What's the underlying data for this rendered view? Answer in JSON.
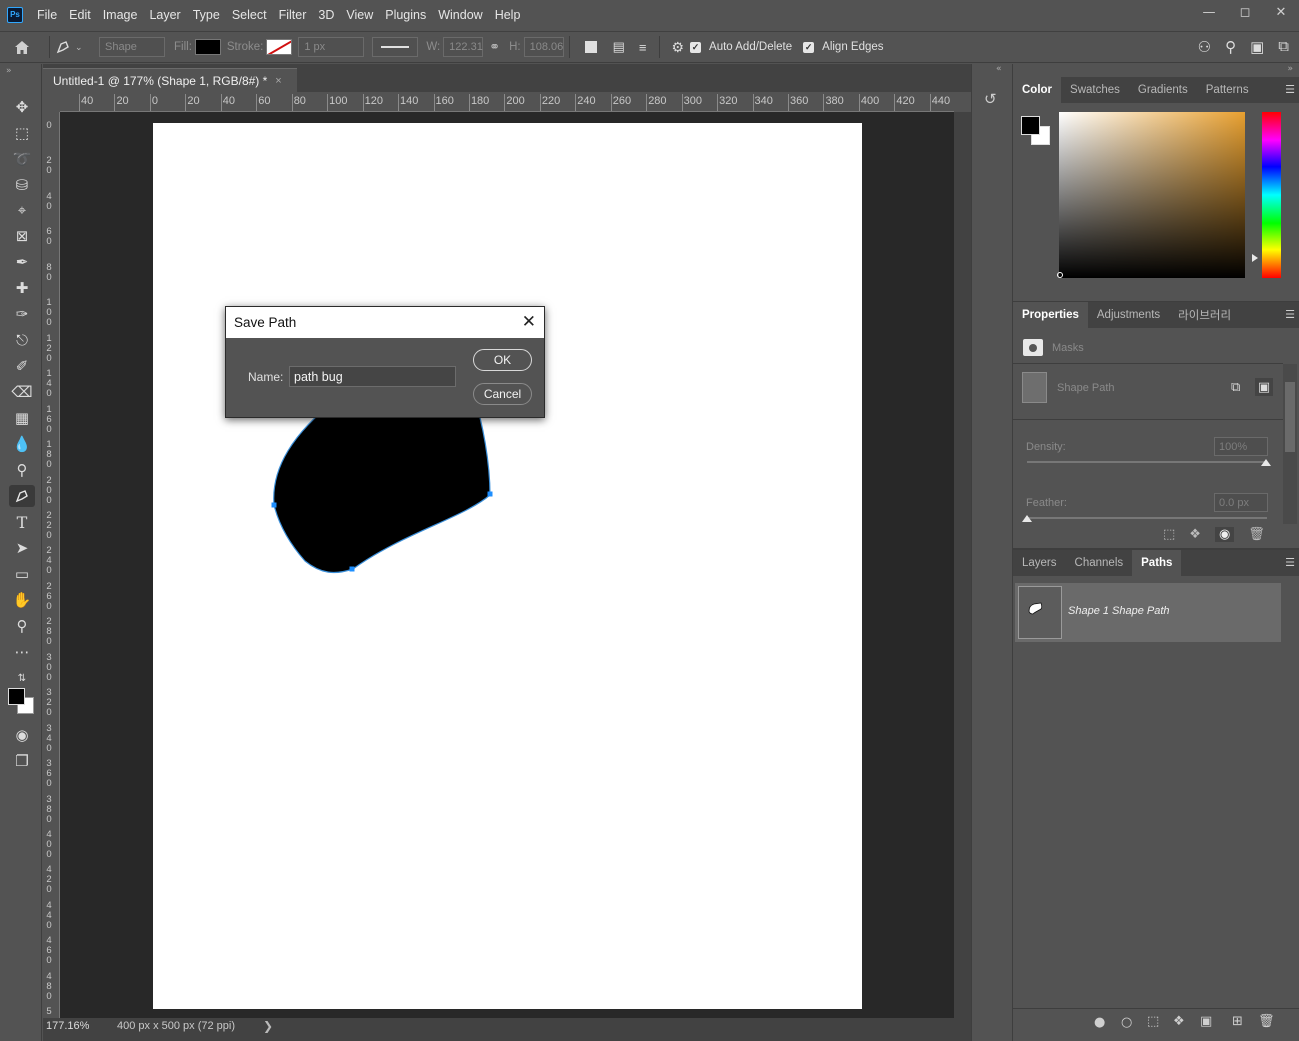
{
  "app": {
    "logo": "Ps",
    "menu": [
      "File",
      "Edit",
      "Image",
      "Layer",
      "Type",
      "Select",
      "Filter",
      "3D",
      "View",
      "Plugins",
      "Window",
      "Help"
    ],
    "window_controls": [
      "minimize",
      "maximize",
      "close"
    ]
  },
  "options_bar": {
    "mode_value": "Shape",
    "fill_label": "Fill:",
    "stroke_label": "Stroke:",
    "stroke_width": "1 px",
    "w_label": "W:",
    "w_value": "122.31",
    "h_label": "H:",
    "h_value": "108.06",
    "auto_add_delete": "Auto Add/Delete",
    "align_edges": "Align Edges"
  },
  "document": {
    "tab_title": "Untitled-1 @ 177% (Shape 1, RGB/8#) *",
    "close_glyph": "×",
    "zoom": "177.16%",
    "info": "400 px x 500 px (72 ppi)",
    "ruler_h_labels": [
      "40",
      "20",
      "0",
      "20",
      "40",
      "60",
      "80",
      "100",
      "120",
      "140",
      "160",
      "180",
      "200",
      "220",
      "240",
      "260",
      "280",
      "300",
      "320",
      "340",
      "360",
      "380",
      "400",
      "420",
      "440"
    ],
    "ruler_v_labels": [
      "0",
      "20",
      "40",
      "60",
      "80",
      "100",
      "120",
      "140",
      "160",
      "180",
      "200",
      "220",
      "240",
      "260",
      "280",
      "300",
      "320",
      "340",
      "360",
      "380",
      "400",
      "420",
      "440",
      "460",
      "480",
      "5"
    ]
  },
  "dialog": {
    "title": "Save Path",
    "name_label": "Name:",
    "name_value": "path bug",
    "ok_label": "OK",
    "cancel_label": "Cancel"
  },
  "color_panel": {
    "tabs": [
      "Color",
      "Swatches",
      "Gradients",
      "Patterns"
    ],
    "foreground": "#000000",
    "background": "#ffffff"
  },
  "properties_panel": {
    "tabs": [
      "Properties",
      "Adjustments",
      "라이브러리"
    ],
    "section": "Masks",
    "item": "Shape Path",
    "density_label": "Density:",
    "density_value": "100%",
    "feather_label": "Feather:",
    "feather_value": "0.0 px"
  },
  "paths_panel": {
    "tabs": [
      "Layers",
      "Channels",
      "Paths"
    ],
    "path_name": "Shape 1 Shape Path"
  },
  "colors": {
    "ui_bg": "#535353",
    "canvas_bg": "#282828",
    "anchor": "#1e8fff"
  }
}
